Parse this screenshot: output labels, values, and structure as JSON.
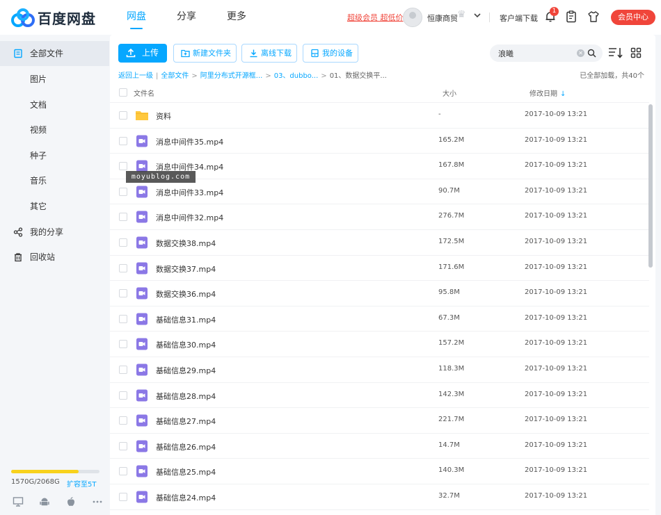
{
  "app": {
    "logo_text": "百度网盘"
  },
  "nav": [
    {
      "label": "网盘",
      "active": true
    },
    {
      "label": "分享",
      "active": false
    },
    {
      "label": "更多",
      "active": false
    }
  ],
  "header": {
    "vip_promo": "超级会员 超低价",
    "username": "恒康商贸",
    "client_download": "客户端下载",
    "notification_count": "1",
    "vip_center": "会员中心"
  },
  "sidebar": {
    "items": [
      {
        "label": "全部文件",
        "icon": "files-icon",
        "active": true
      },
      {
        "label": "图片"
      },
      {
        "label": "文档"
      },
      {
        "label": "视频"
      },
      {
        "label": "种子"
      },
      {
        "label": "音乐"
      },
      {
        "label": "其它"
      },
      {
        "label": "我的分享",
        "icon": "share-icon"
      },
      {
        "label": "回收站",
        "icon": "trash-icon"
      }
    ],
    "storage_used_fraction": 0.76,
    "storage_text": "1570G/2068G",
    "expand_link": "扩容至5T"
  },
  "toolbar": {
    "upload": "上传",
    "new_folder": "新建文件夹",
    "offline_download": "离线下载",
    "my_devices": "我的设备",
    "search_value": "浪曦"
  },
  "breadcrumb": {
    "back": "返回上一级",
    "items": [
      "全部文件",
      "阿里分布式开源框...",
      "03、dubbo...",
      "01、数据交换平..."
    ],
    "loaded_info": "已全部加载，共40个"
  },
  "table": {
    "headers": {
      "name": "文件名",
      "size": "大小",
      "date": "修改日期"
    },
    "rows": [
      {
        "type": "folder",
        "name": "资料",
        "size": "-",
        "date": "2017-10-09 13:21"
      },
      {
        "type": "video",
        "name": "消息中间件35.mp4",
        "size": "165.2M",
        "date": "2017-10-09 13:21"
      },
      {
        "type": "video",
        "name": "消息中间件34.mp4",
        "size": "167.8M",
        "date": "2017-10-09 13:21"
      },
      {
        "type": "video",
        "name": "消息中间件33.mp4",
        "size": "90.7M",
        "date": "2017-10-09 13:21"
      },
      {
        "type": "video",
        "name": "消息中间件32.mp4",
        "size": "276.7M",
        "date": "2017-10-09 13:21"
      },
      {
        "type": "video",
        "name": "数据交换38.mp4",
        "size": "172.5M",
        "date": "2017-10-09 13:21"
      },
      {
        "type": "video",
        "name": "数据交换37.mp4",
        "size": "171.6M",
        "date": "2017-10-09 13:21"
      },
      {
        "type": "video",
        "name": "数据交换36.mp4",
        "size": "95.8M",
        "date": "2017-10-09 13:21"
      },
      {
        "type": "video",
        "name": "基础信息31.mp4",
        "size": "67.3M",
        "date": "2017-10-09 13:21"
      },
      {
        "type": "video",
        "name": "基础信息30.mp4",
        "size": "157.2M",
        "date": "2017-10-09 13:21"
      },
      {
        "type": "video",
        "name": "基础信息29.mp4",
        "size": "118.3M",
        "date": "2017-10-09 13:21"
      },
      {
        "type": "video",
        "name": "基础信息28.mp4",
        "size": "142.3M",
        "date": "2017-10-09 13:21"
      },
      {
        "type": "video",
        "name": "基础信息27.mp4",
        "size": "221.7M",
        "date": "2017-10-09 13:21"
      },
      {
        "type": "video",
        "name": "基础信息26.mp4",
        "size": "14.7M",
        "date": "2017-10-09 13:21"
      },
      {
        "type": "video",
        "name": "基础信息25.mp4",
        "size": "140.3M",
        "date": "2017-10-09 13:21"
      },
      {
        "type": "video",
        "name": "基础信息24.mp4",
        "size": "32.7M",
        "date": "2017-10-09 13:21"
      }
    ]
  },
  "watermark": "moyublog.com",
  "colors": {
    "accent": "#06a7ff",
    "vip_red": "#f0453a",
    "folder": "#ffc83d",
    "video": "#8b78e6",
    "storage": "#f8d21d"
  }
}
